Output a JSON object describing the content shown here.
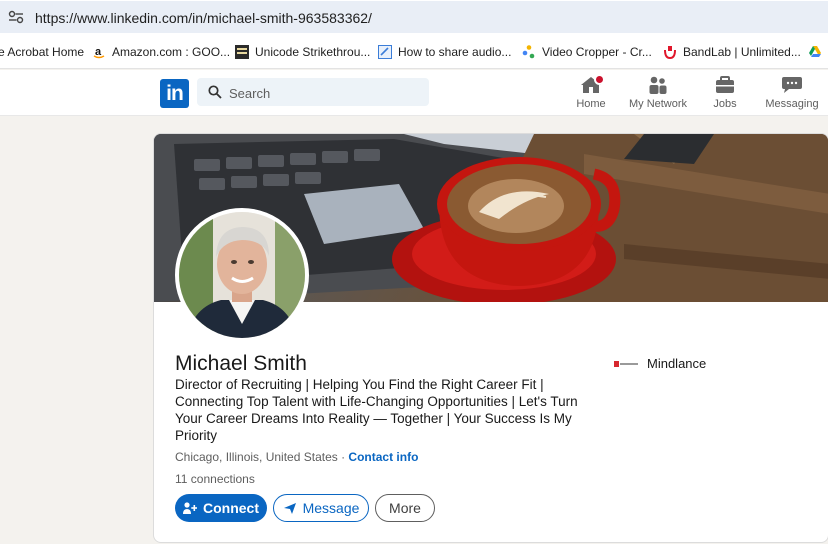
{
  "browser": {
    "url": "https://www.linkedin.com/in/michael-smith-963583362/"
  },
  "bookmarks": [
    {
      "label": "e Acrobat Home",
      "icon": "acrobat-icon"
    },
    {
      "label": "Amazon.com : GOO...",
      "icon": "amazon-icon"
    },
    {
      "label": "Unicode Strikethrou...",
      "icon": "unicode-icon"
    },
    {
      "label": "How to share audio...",
      "icon": "article-icon"
    },
    {
      "label": "Video Cropper - Cr...",
      "icon": "dots-icon"
    },
    {
      "label": "BandLab | Unlimited...",
      "icon": "bandlab-icon"
    }
  ],
  "nav": {
    "logo": "in",
    "search_placeholder": "Search",
    "items": [
      {
        "label": "Home",
        "icon": "home-icon"
      },
      {
        "label": "My Network",
        "icon": "network-icon"
      },
      {
        "label": "Jobs",
        "icon": "briefcase-icon"
      },
      {
        "label": "Messaging",
        "icon": "chat-icon"
      }
    ]
  },
  "profile": {
    "name": "Michael Smith",
    "headline": "Director of Recruiting | Helping You Find the Right Career Fit | Connecting Top Talent with Life-Changing Opportunities | Let's Turn Your Career Dreams Into Reality — Together | Your Success Is My Priority",
    "location": "Chicago, Illinois, United States",
    "separator": " · ",
    "contact_label": "Contact info",
    "connections": "11 connections",
    "company": "Mindlance",
    "buttons": {
      "connect": "Connect",
      "message": "Message",
      "more": "More"
    }
  },
  "colors": {
    "brand": "#0a66c2",
    "notification": "#cb112d",
    "page_bg": "#f4f2ee"
  }
}
